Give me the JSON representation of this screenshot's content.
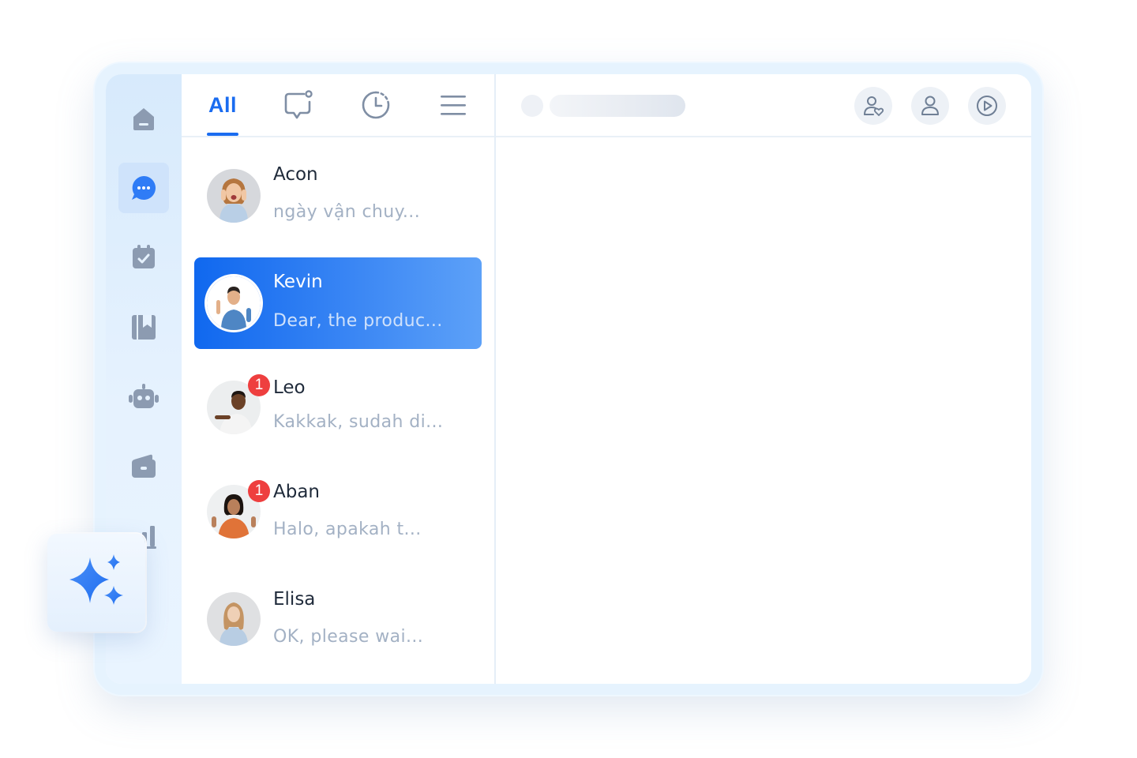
{
  "tabs": {
    "all_label": "All",
    "active": "All"
  },
  "conversations": [
    {
      "name": "Acon",
      "preview": "ngày vận chuy...",
      "unread": "",
      "selected": false
    },
    {
      "name": "Kevin",
      "preview": "Dear, the produc...",
      "unread": "",
      "selected": true
    },
    {
      "name": "Leo",
      "preview": "Kakkak, sudah di...",
      "unread": "1",
      "selected": false
    },
    {
      "name": "Aban",
      "preview": "Halo, apakah t...",
      "unread": "1",
      "selected": false
    },
    {
      "name": "Elisa",
      "preview": "OK, please wai...",
      "unread": "",
      "selected": false
    }
  ],
  "nav_icons": [
    "home-icon",
    "chat-icon",
    "calendar-check-icon",
    "bookmark-book-icon",
    "robot-icon",
    "wallet-icon",
    "bar-chart-icon"
  ],
  "header_icons": [
    "user-heart-icon",
    "user-icon",
    "play-circle-icon"
  ],
  "colors": {
    "accent": "#1a6cf0",
    "selected_gradient_start": "#1068ef",
    "selected_gradient_end": "#5da1f8",
    "badge": "#ee3f3f",
    "nav_icon": "#8c9bb1",
    "nav_icon_active": "#2f7cf6"
  }
}
